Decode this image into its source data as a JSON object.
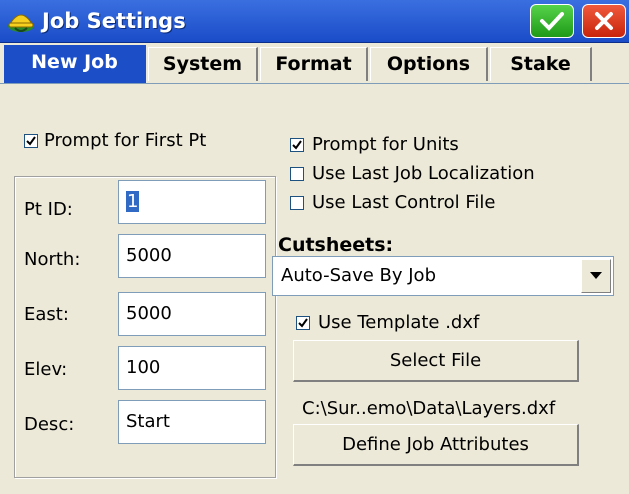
{
  "window": {
    "title": "Job Settings",
    "ok_icon": "checkmark-icon",
    "close_icon": "close-icon"
  },
  "tabs": [
    {
      "label": "New Job",
      "active": true
    },
    {
      "label": "System",
      "active": false
    },
    {
      "label": "Format",
      "active": false
    },
    {
      "label": "Options",
      "active": false
    },
    {
      "label": "Stake",
      "active": false
    }
  ],
  "options": {
    "prompt_first_pt": {
      "label": "Prompt for First Pt",
      "checked": true
    },
    "prompt_units": {
      "label": "Prompt for Units",
      "checked": true
    },
    "use_last_localization": {
      "label": "Use Last Job Localization",
      "checked": false
    },
    "use_last_control": {
      "label": "Use Last Control File",
      "checked": false
    }
  },
  "point": {
    "pt_id": {
      "label": "Pt ID:",
      "value": "1"
    },
    "north": {
      "label": "North:",
      "value": "5000"
    },
    "east": {
      "label": "East:",
      "value": "5000"
    },
    "elev": {
      "label": "Elev:",
      "value": "100"
    },
    "desc": {
      "label": "Desc:",
      "value": "Start"
    }
  },
  "cutsheets": {
    "heading": "Cutsheets:",
    "selected": "Auto-Save By Job",
    "use_template": {
      "label": "Use Template .dxf",
      "checked": true
    },
    "select_file_label": "Select File",
    "file_path": "C:\\Sur..emo\\Data\\Layers.dxf"
  },
  "define_attributes_label": "Define Job Attributes",
  "colors": {
    "accent": "#1c4ec8",
    "ok": "#1f9a18",
    "close": "#c8240c",
    "background": "#ECE9D8"
  }
}
